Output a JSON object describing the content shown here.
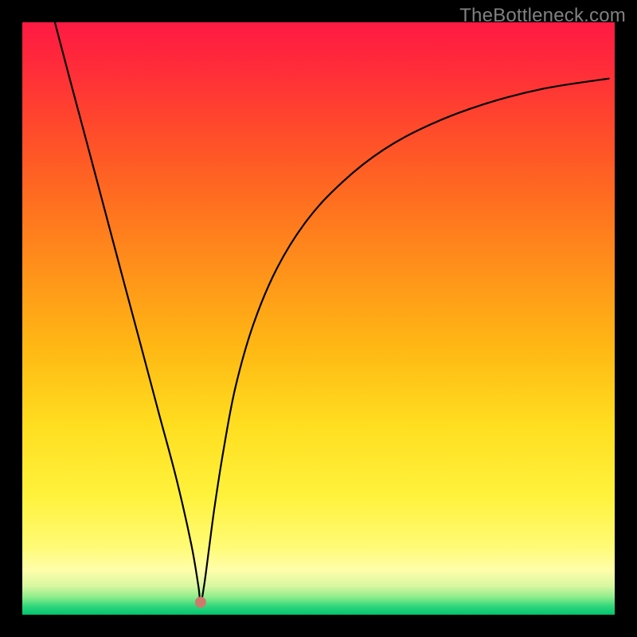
{
  "watermark": "TheBottleneck.com",
  "chart_data": {
    "type": "line",
    "title": "",
    "xlabel": "",
    "ylabel": "",
    "xlim": [
      0,
      1
    ],
    "ylim": [
      0,
      1
    ],
    "grid": false,
    "legend": false,
    "curve": {
      "x": [
        0.055,
        0.08,
        0.11,
        0.14,
        0.17,
        0.2,
        0.23,
        0.26,
        0.285,
        0.297,
        0.301,
        0.307,
        0.315,
        0.325,
        0.34,
        0.36,
        0.39,
        0.43,
        0.48,
        0.54,
        0.61,
        0.69,
        0.78,
        0.88,
        0.99
      ],
      "y": [
        1.0,
        0.905,
        0.793,
        0.68,
        0.567,
        0.455,
        0.342,
        0.23,
        0.12,
        0.05,
        0.021,
        0.05,
        0.11,
        0.185,
        0.28,
        0.385,
        0.49,
        0.585,
        0.665,
        0.73,
        0.785,
        0.828,
        0.862,
        0.888,
        0.905
      ]
    },
    "min_marker": {
      "x": 0.301,
      "y": 0.021,
      "color": "#cd7a6c",
      "radius_px": 7
    },
    "gradient_stops": [
      {
        "offset": 0.0,
        "color": "#ff1a43"
      },
      {
        "offset": 0.07,
        "color": "#ff2a3a"
      },
      {
        "offset": 0.18,
        "color": "#ff4a2b"
      },
      {
        "offset": 0.3,
        "color": "#ff6e20"
      },
      {
        "offset": 0.42,
        "color": "#ff921a"
      },
      {
        "offset": 0.55,
        "color": "#ffb814"
      },
      {
        "offset": 0.68,
        "color": "#ffde20"
      },
      {
        "offset": 0.8,
        "color": "#fff23c"
      },
      {
        "offset": 0.885,
        "color": "#fffb75"
      },
      {
        "offset": 0.925,
        "color": "#fffeaa"
      },
      {
        "offset": 0.952,
        "color": "#d6f7a0"
      },
      {
        "offset": 0.97,
        "color": "#8fed8c"
      },
      {
        "offset": 0.985,
        "color": "#34d77c"
      },
      {
        "offset": 1.0,
        "color": "#00c56e"
      }
    ]
  }
}
